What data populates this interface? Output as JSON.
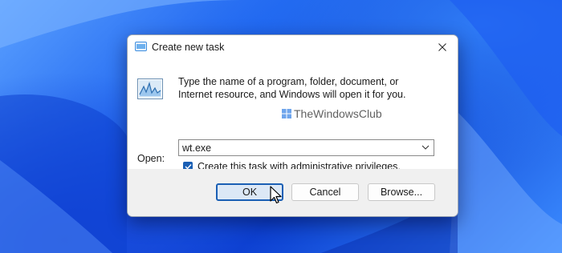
{
  "dialog": {
    "title": "Create new task",
    "description": "Type the name of a program, folder, document, or Internet resource, and Windows will open it for you.",
    "open_label": "Open:",
    "open_value": "wt.exe",
    "admin_checkbox": {
      "label": "Create this task with administrative privileges.",
      "checked": true
    },
    "buttons": {
      "ok": "OK",
      "cancel": "Cancel",
      "browse": "Browse..."
    }
  },
  "watermark": "TheWindowsClub",
  "icons": {
    "title": "run-task-icon",
    "large": "task-manager-graph-icon",
    "close": "close-icon",
    "dropdown": "chevron-down-icon",
    "watermark": "windows-club-logo-icon",
    "cursor": "mouse-pointer-icon"
  },
  "colors": {
    "accent": "#1a5fb4",
    "wallpaper": "#1d63ef"
  }
}
